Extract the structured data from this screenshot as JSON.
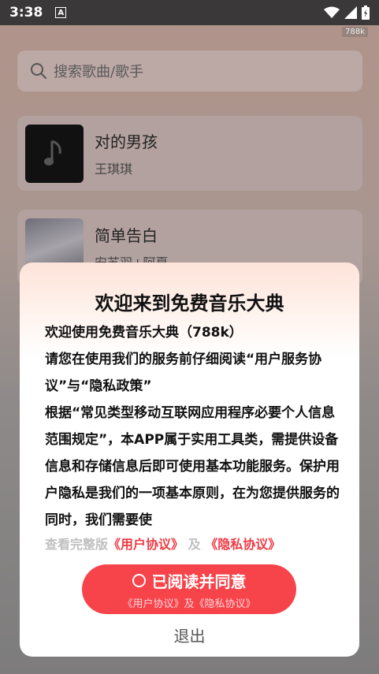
{
  "status_bar": {
    "time": "3:38",
    "notification_icon": "A",
    "icons": [
      "wifi-icon",
      "signal-icon",
      "battery-icon"
    ]
  },
  "overlay_badge": "788k",
  "search": {
    "placeholder": "搜索歌曲/歌手"
  },
  "songs": [
    {
      "title": "对的男孩",
      "artist": "王琪琪"
    },
    {
      "title": "简单告白",
      "artist": "安苏羽+阿夏"
    }
  ],
  "dialog": {
    "title": "欢迎来到免费音乐大典",
    "paragraphs": [
      "欢迎使用免费音乐大典（788k）",
      "请您在使用我们的服务前仔细阅读“用户服务协议”与“隐私政策”",
      "根据“常见类型移动互联网应用程序必要个人信息范围规定”，本APP属于实用工具类，需提供设备信息和存储信息后即可使用基本功能服务。保护用户隐私是我们的一项基本原则，在为您提供服务的同时，我们需要使"
    ],
    "links_prefix": "查看完整版",
    "user_agreement": "《用户协议》",
    "and": "及",
    "privacy_agreement": "《隐私协议》",
    "agree_label": "已阅读并同意",
    "agree_sub": "《用户协议》及《隐私协议》",
    "exit_label": "退出"
  },
  "colors": {
    "accent": "#f7434a",
    "link": "#ef3b45"
  }
}
